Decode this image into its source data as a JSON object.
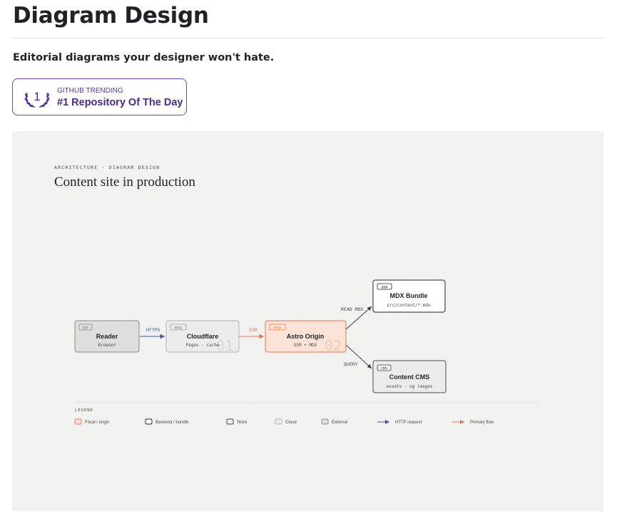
{
  "page": {
    "title": "Diagram Design",
    "tagline": "Editorial diagrams your designer won't hate."
  },
  "badge": {
    "rank": "1",
    "subtitle": "GITHUB TRENDING",
    "label": "#1 Repository Of The Day",
    "accent": "#6f42c1"
  },
  "diagram": {
    "eyebrow": "ARCHITECTURE · DIAGRAM DESIGN",
    "title": "Content site in production",
    "nodes": {
      "reader": {
        "tag": "EXT",
        "name": "Reader",
        "detail": "Browser"
      },
      "cloudflare": {
        "tag": "EDGE",
        "name": "Cloudflare",
        "detail": "Pages · cache",
        "index": "01"
      },
      "astro": {
        "tag": "ORIG",
        "name": "Astro Origin",
        "detail": "SSR + MDX",
        "index": "02"
      },
      "mdx": {
        "tag": "BUN",
        "name": "MDX Bundle",
        "detail": "src/content/*.mdx"
      },
      "cms": {
        "tag": "CMS",
        "name": "Content CMS",
        "detail": "assets · og images"
      }
    },
    "edges": {
      "https": "HTTPS",
      "ssr": "SSR",
      "read_mdx": "READ MDX",
      "query": "QUERY"
    },
    "legend": {
      "title": "LEGEND",
      "items": [
        "Focal / origin",
        "Backend / bundle",
        "Store",
        "Cloud",
        "External",
        "HTTP request",
        "Primary flow"
      ]
    },
    "colors": {
      "accent": "#e8764a",
      "link": "#3a5aa0",
      "ink": "#1f2328"
    }
  }
}
